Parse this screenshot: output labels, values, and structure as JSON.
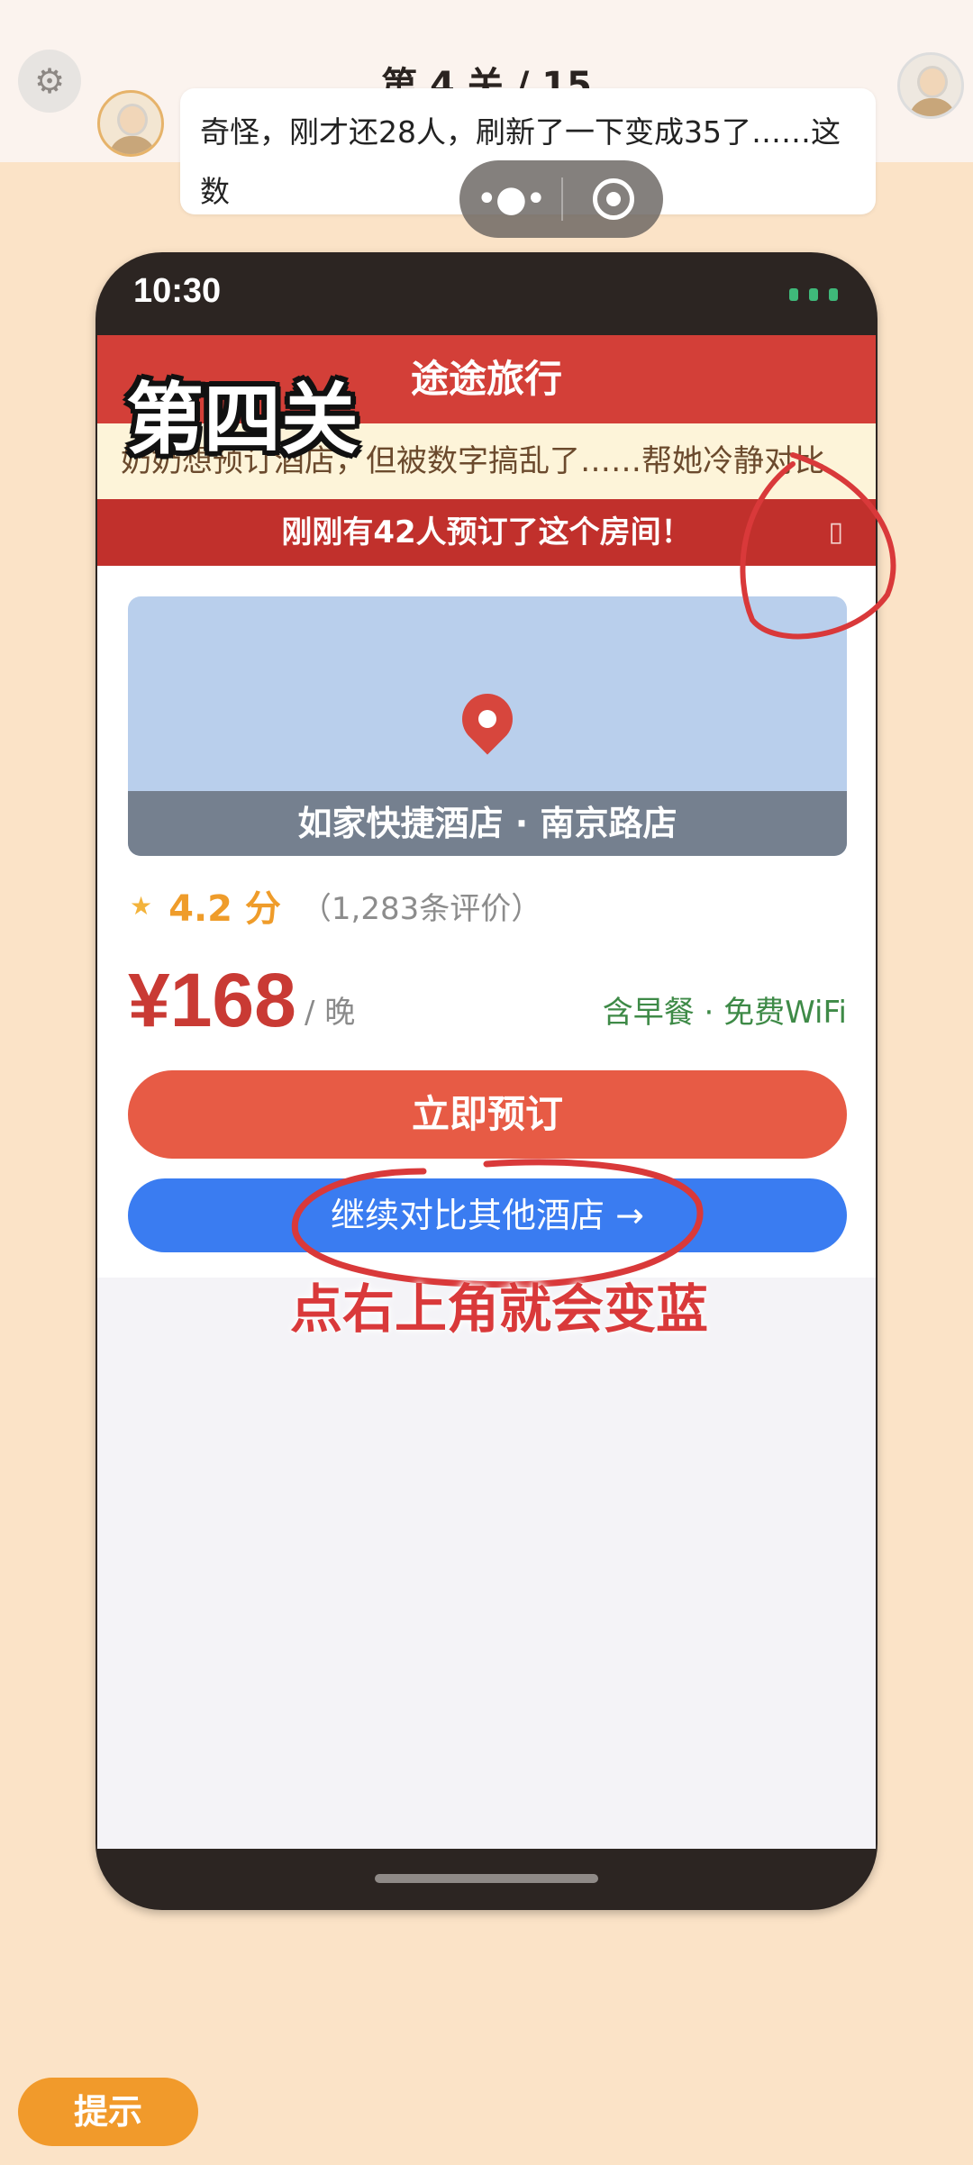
{
  "game": {
    "level_title": "第 4 关 / 15",
    "dialogue": "奇怪，刚才还28人，刷新了一下变成35了……这数",
    "hint_label": "提示",
    "settings_icon": "gear-icon"
  },
  "miniprogram_capsule": {
    "more_icon": "more-dots-icon",
    "close_icon": "target-close-icon"
  },
  "phone": {
    "time": "10:30"
  },
  "app": {
    "title": "途途旅行",
    "marquee": "奶奶想预订酒店，但被数字搞乱了……帮她冷静对比",
    "alert": "刚刚有42人预订了这个房间！",
    "alert_close": "▯",
    "hotel_name": "如家快捷酒店 · 南京路店",
    "rating_score": "4.2 分",
    "rating_count": "（1,283条评价）",
    "price": "¥168",
    "per_night": "/ 晚",
    "amenities": "含早餐 · 免费WiFi",
    "book_button": "立即预订",
    "compare_button": "继续对比其他酒店 →"
  },
  "overlay": {
    "stage_label": "第四关",
    "annotation": "点右上角就会变蓝",
    "annotation_color": "#d9393a"
  },
  "colors": {
    "header_red": "#d33f38",
    "alert_red": "#c1302c",
    "book_orange": "#e75b45",
    "compare_blue": "#3a7cf1",
    "background": "#fbe3c7"
  }
}
